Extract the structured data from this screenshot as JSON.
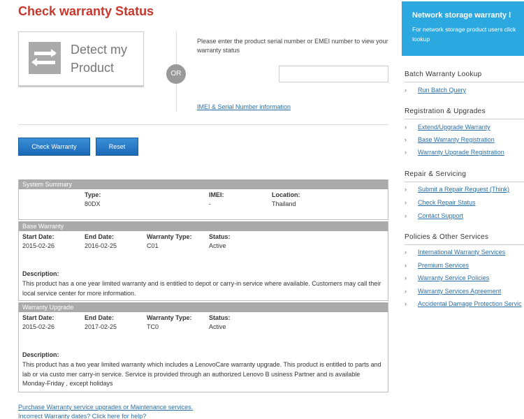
{
  "page": {
    "title": "Check warranty Status"
  },
  "detect": {
    "line1": "Detect my",
    "line2": "Product",
    "or": "OR"
  },
  "serial": {
    "prompt": "Please enter the product serial number or EMEI number to view your warranty status",
    "value": "",
    "placeholder": "",
    "imei_link": "IMEI & Serial Number information"
  },
  "buttons": {
    "check": "Check Warranty",
    "reset": "Reset"
  },
  "system_summary": {
    "header": "System Summary",
    "type_label": "Type:",
    "type_value": "80DX",
    "imei_label": "IMEI:",
    "imei_value": "-",
    "location_label": "Location:",
    "location_value": "Thailand"
  },
  "base_warranty": {
    "header": "Base Warranty",
    "start_label": "Start Date:",
    "start_value": "2015-02-26",
    "end_label": "End Date:",
    "end_value": "2016-02-25",
    "type_label": "Warranty Type:",
    "type_value": "C01",
    "status_label": "Status:",
    "status_value": "Active",
    "desc_label": "Description:",
    "desc_line1": "This product has a one year limited warranty and is entitled to depot or carry-in service where available. Customers may call their",
    "desc_line2": "local service center for more information."
  },
  "warranty_upgrade": {
    "header": "Warranty Upgrade",
    "start_label": "Start Date:",
    "start_value": "2015-02-26",
    "end_label": "End Date:",
    "end_value": "2017-02-25",
    "type_label": "Warranty Type:",
    "type_value": "TC0",
    "status_label": "Status:",
    "status_value": "Active",
    "desc_label": "Description:",
    "desc_line1": "This product has a two year limited warranty which includes a LenovoCare warranty upgrade. This product is entitled to parts and",
    "desc_line2": "lab or via custo mer carry-in service. Service is provided through an authorized Lenovo B usiness Partner and is available",
    "desc_line3": "Monday-Friday , except holidays"
  },
  "bottom_links": {
    "purchase": "Purchase Warranty service upgrades or Maintenance services.",
    "incorrect": "Incorrect Warranty dates? Click here for help?"
  },
  "sidebar": {
    "network": {
      "title": "Network storage warranty l",
      "text_line1": "For network storage product users click",
      "text_line2": "lookup"
    },
    "batch": {
      "heading": "Batch Warranty Lookup",
      "items": [
        "Run Batch Query"
      ]
    },
    "registration": {
      "heading": "Registration & Upgrades",
      "items": [
        "Extend/Upgrade Warranty",
        "Base Warranty Registration",
        "Warranty Upgrade Registration"
      ]
    },
    "repair": {
      "heading": "Repair & Servicing",
      "items": [
        "Submit a Repair Request (Think)",
        "Check Repair Status",
        "Contact Support"
      ]
    },
    "policies": {
      "heading": "Policies & Other Services",
      "items": [
        "International Warranty Services",
        "Premium Services",
        "Warranty Service Policies",
        "Warranty Services Agreement",
        "Accidental Damage Protection Servic"
      ]
    },
    "chevron": "›"
  },
  "colors": {
    "title_red": "#c8372d",
    "button_blue": "#1b68b6",
    "banner_blue": "#2ba8e0",
    "link_blue": "#2a6fa8",
    "section_gray": "#aaaaaa"
  }
}
